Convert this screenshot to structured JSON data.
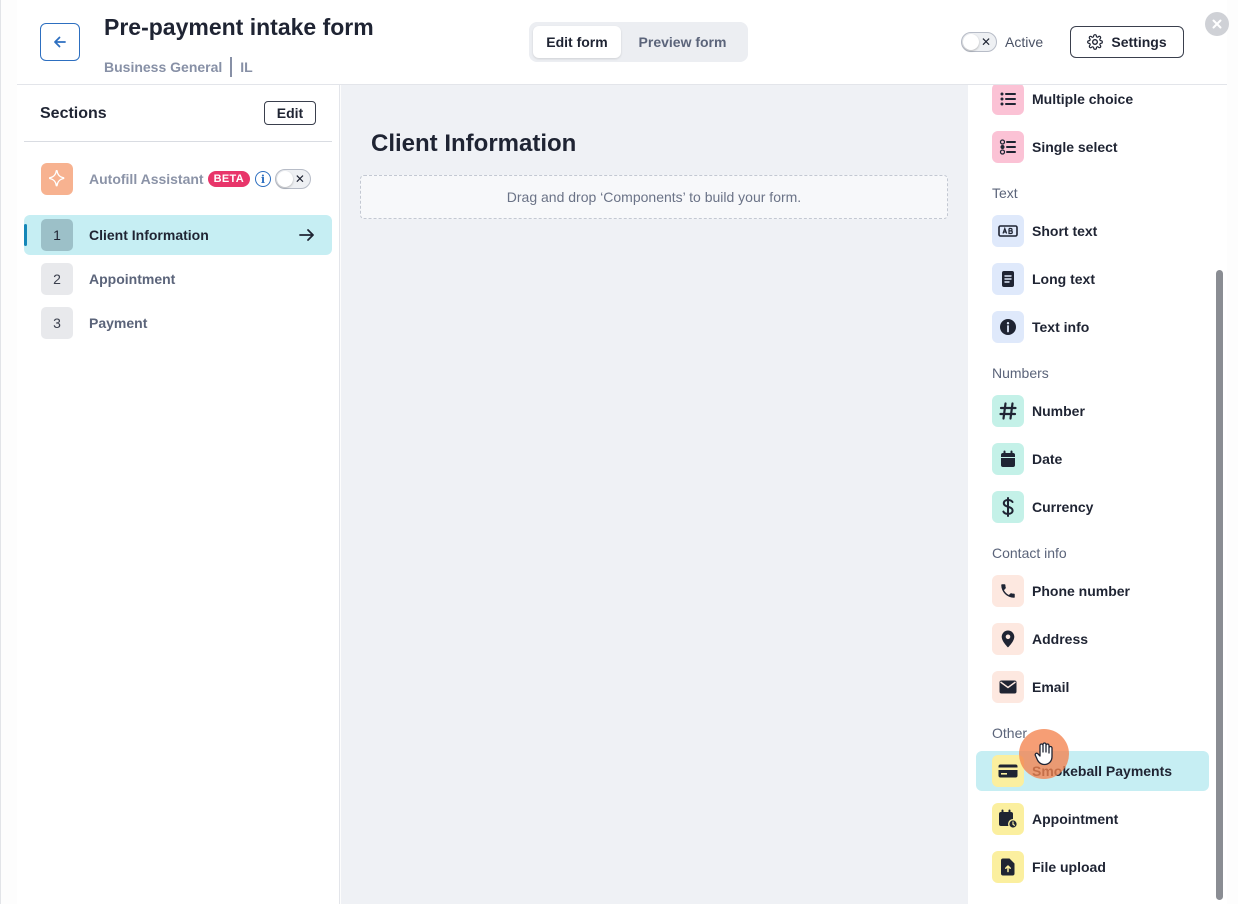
{
  "header": {
    "title": "Pre-payment intake form",
    "practice_area": "Business General",
    "state": "IL",
    "tabs": [
      {
        "label": "Edit form",
        "active": true
      },
      {
        "label": "Preview form",
        "active": false
      }
    ],
    "active_label": "Active",
    "settings_label": "Settings"
  },
  "sidebar": {
    "heading": "Sections",
    "edit_label": "Edit",
    "autofill": {
      "label": "Autofill Assistant",
      "badge": "BETA"
    },
    "sections": [
      {
        "number": "1",
        "label": "Client Information",
        "selected": true
      },
      {
        "number": "2",
        "label": "Appointment",
        "selected": false
      },
      {
        "number": "3",
        "label": "Payment",
        "selected": false
      }
    ]
  },
  "canvas": {
    "section_title": "Client Information",
    "dropzone_text": "Drag and drop ‘Components’ to build your form."
  },
  "components": {
    "top_items": [
      {
        "label": "Multiple choice",
        "icon": "list-icon"
      },
      {
        "label": "Single select",
        "icon": "radio-list-icon"
      }
    ],
    "text_heading": "Text",
    "text_items": [
      {
        "label": "Short text",
        "icon": "short-text-icon"
      },
      {
        "label": "Long text",
        "icon": "document-icon"
      },
      {
        "label": "Text info",
        "icon": "info-icon"
      }
    ],
    "numbers_heading": "Numbers",
    "numbers_items": [
      {
        "label": "Number",
        "icon": "hash-icon"
      },
      {
        "label": "Date",
        "icon": "calendar-icon"
      },
      {
        "label": "Currency",
        "icon": "dollar-icon"
      }
    ],
    "contact_heading": "Contact info",
    "contact_items": [
      {
        "label": "Phone number",
        "icon": "phone-icon"
      },
      {
        "label": "Address",
        "icon": "map-pin-icon"
      },
      {
        "label": "Email",
        "icon": "envelope-icon"
      }
    ],
    "other_heading": "Other",
    "other_items": [
      {
        "label": "Smokeball Payments",
        "icon": "credit-card-icon",
        "hover": true
      },
      {
        "label": "Appointment",
        "icon": "calendar-clock-icon"
      },
      {
        "label": "File upload",
        "icon": "file-upload-icon"
      }
    ]
  },
  "colors": {
    "accent": "#2d6fc0",
    "selected_bg": "#c6eef3",
    "beta_badge": "#e8356a",
    "cursor_highlight": "#f4834e"
  }
}
